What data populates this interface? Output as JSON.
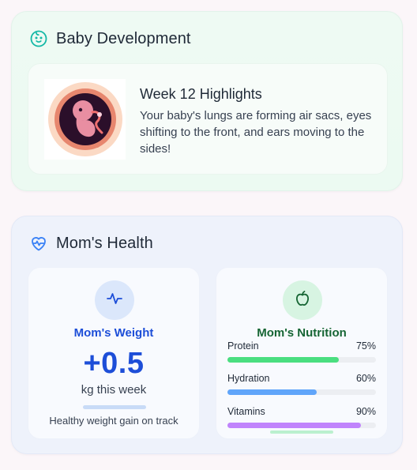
{
  "baby": {
    "title": "Baby Development",
    "highlight": {
      "title": "Week 12 Highlights",
      "text": "Your baby's lungs are forming air sacs, eyes shifting to the front, and ears moving to the sides!"
    }
  },
  "mom": {
    "title": "Mom's Health",
    "weight": {
      "title": "Mom's Weight",
      "value": "+0.5",
      "unit": "kg this week",
      "note": "Healthy weight gain on track"
    },
    "nutrition": {
      "title": "Mom's Nutrition",
      "items": [
        {
          "label": "Protein",
          "percent_text": "75%",
          "percent": 75
        },
        {
          "label": "Hydration",
          "percent_text": "60%",
          "percent": 60
        },
        {
          "label": "Vitamins",
          "percent_text": "90%",
          "percent": 90
        }
      ]
    }
  },
  "colors": {
    "baby_accent": "#14b8a6",
    "health_accent": "#3b82f6",
    "weight_accent": "#1d4ed8",
    "nutrition_accent": "#166534",
    "protein": "#4ade80",
    "hydration": "#60a5fa",
    "vitamins": "#c084fc"
  },
  "icons": {
    "baby": "baby-face-icon",
    "health": "heart-pulse-icon",
    "weight": "activity-icon",
    "nutrition": "apple-icon"
  }
}
